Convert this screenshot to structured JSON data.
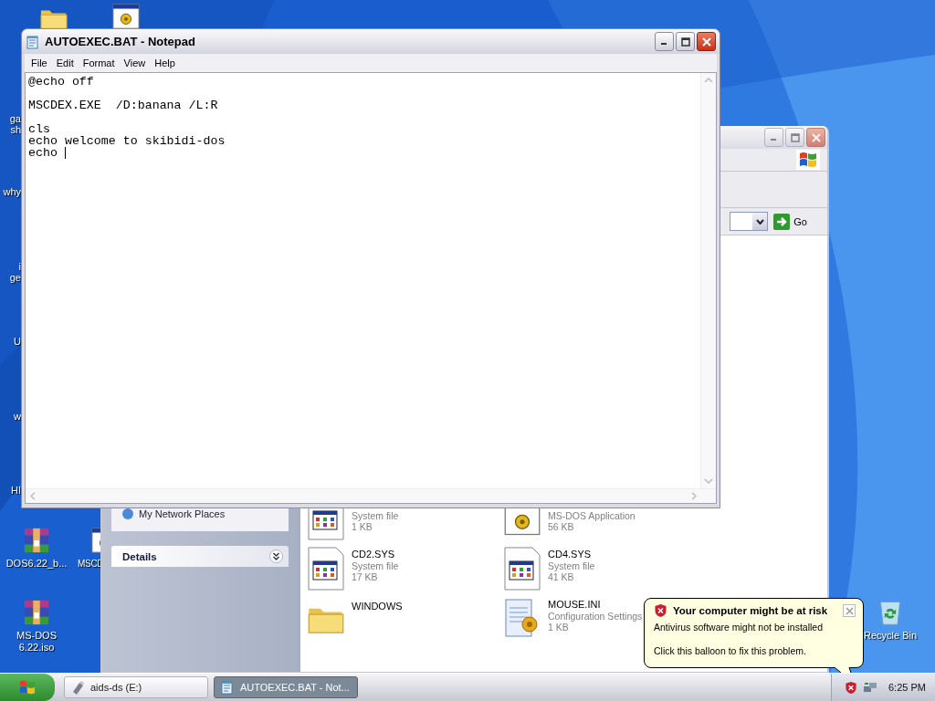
{
  "desktop": {
    "icons": [
      {
        "kind": "folder"
      },
      {
        "kind": "program"
      },
      {
        "kind": "archive",
        "label": [
          "DOS6.22_b..."
        ]
      },
      {
        "kind": "program",
        "label": [
          "MSCD"
        ]
      },
      {
        "kind": "archive",
        "label": [
          "MS-DOS",
          "6.22.iso"
        ]
      },
      {
        "kind": "recycle_bin",
        "label": [
          "Recycle Bin"
        ]
      }
    ],
    "cut_labels": [
      [
        "ga",
        "sh"
      ],
      [
        "why"
      ],
      [
        "i",
        "ge"
      ],
      [
        "U"
      ],
      [
        "w"
      ],
      [
        "HI"
      ]
    ]
  },
  "explorer": {
    "go": "Go",
    "sidebar": [
      {
        "label": "My Network Places"
      }
    ],
    "details": {
      "title": "Details",
      "expanded": false
    },
    "files": [
      {
        "kind": "sysfile",
        "type": "System file",
        "size": "1 KB"
      },
      {
        "kind": "application",
        "type": "MS-DOS Application",
        "size": "56 KB"
      },
      {
        "kind": "sysfile",
        "name": "CD2.SYS",
        "type": "System file",
        "size": "17 KB"
      },
      {
        "kind": "sysfile",
        "name": "CD4.SYS",
        "type": "System file",
        "size": "41 KB"
      },
      {
        "kind": "folder",
        "name": "WINDOWS"
      },
      {
        "kind": "settings",
        "name": "MOUSE.INI",
        "type": "Configuration Settings",
        "size": "1 KB"
      }
    ]
  },
  "notepad": {
    "title": "AUTOEXEC.BAT - Notepad",
    "menu": [
      "File",
      "Edit",
      "Format",
      "View",
      "Help"
    ],
    "text": "@echo off\n\nMSCDEX.EXE  /D:banana /L:R\n\ncls\necho welcome to skibidi-dos\necho "
  },
  "balloon": {
    "title": "Your computer might be at risk",
    "lines": [
      "Antivirus software might not be installed",
      "Click this balloon to fix this problem."
    ]
  },
  "taskbar": {
    "tasks": [
      {
        "label": "aids-ds (E:)",
        "kind": "drive",
        "selected": false
      },
      {
        "label": "AUTOEXEC.BAT - Not...",
        "kind": "notepad",
        "selected": true
      }
    ],
    "clock": "6:25 PM"
  }
}
